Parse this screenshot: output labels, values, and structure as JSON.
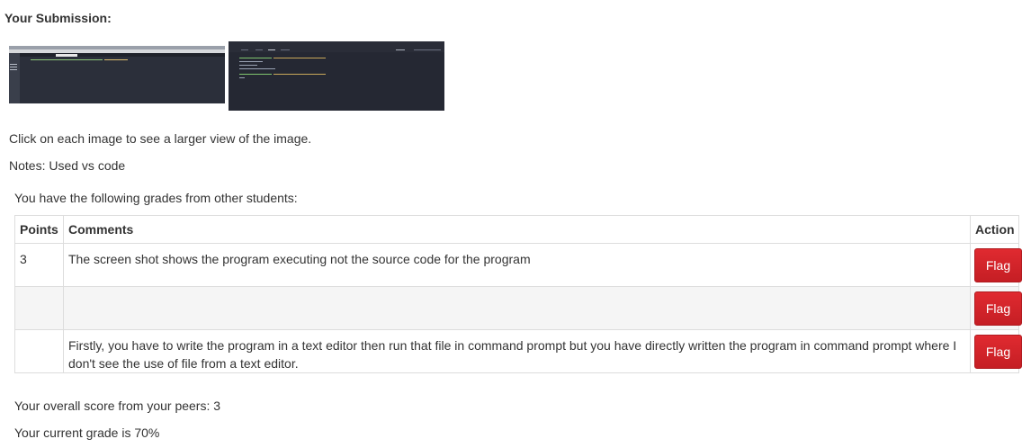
{
  "submission": {
    "heading": "Your Submission:",
    "thumbnails": [
      {
        "name": "editor-screenshot"
      },
      {
        "name": "terminal-screenshot"
      }
    ],
    "click_hint": "Click on each image to see a larger view of the image.",
    "notes": "Notes: Used vs code"
  },
  "grades": {
    "intro": "You have the following grades from other students:",
    "headers": {
      "points": "Points",
      "comments": "Comments",
      "action": "Action"
    },
    "rows": [
      {
        "points": "3",
        "comment": "The screen shot shows the program executing not the source code for the program",
        "action": "Flag"
      },
      {
        "points": "",
        "comment": "",
        "action": "Flag"
      },
      {
        "points": "",
        "comment": "Firstly, you have to write the program in a text editor then run that file in command prompt but you have directly written the program in command prompt where I don't see the use of file from a text editor.",
        "action": "Flag"
      }
    ]
  },
  "summary": {
    "overall": "Your overall score from your peers: 3",
    "current": "Your current grade is 70%"
  },
  "colors": {
    "flag_button": "#d9232a",
    "text": "#333333"
  }
}
